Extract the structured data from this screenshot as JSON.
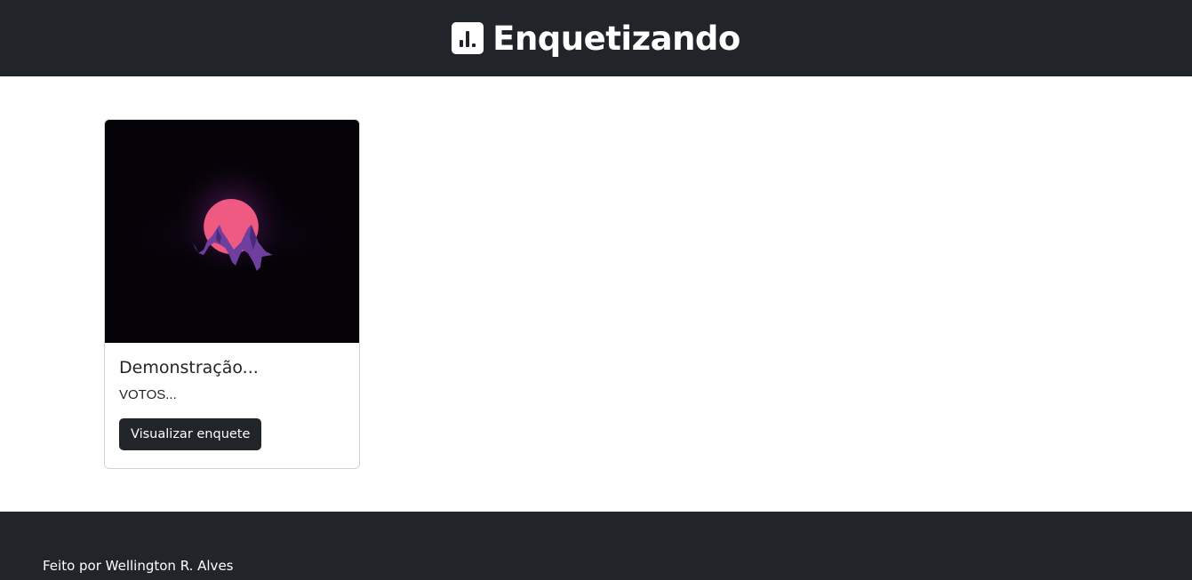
{
  "header": {
    "brand_icon": "bar-chart-icon",
    "brand_title": "Enquetizando",
    "background_color": "#212529"
  },
  "polls": [
    {
      "image": "mountain-moon-illustration",
      "title": "Demonstração...",
      "votes_text": "VOTOS...",
      "button_label": "Visualizar enquete"
    }
  ],
  "footer": {
    "credit": "Feito por Wellington R. Alves"
  },
  "colors": {
    "dark": "#212529",
    "moon": "#ef5a83",
    "mountain": "#6f3fa0"
  }
}
